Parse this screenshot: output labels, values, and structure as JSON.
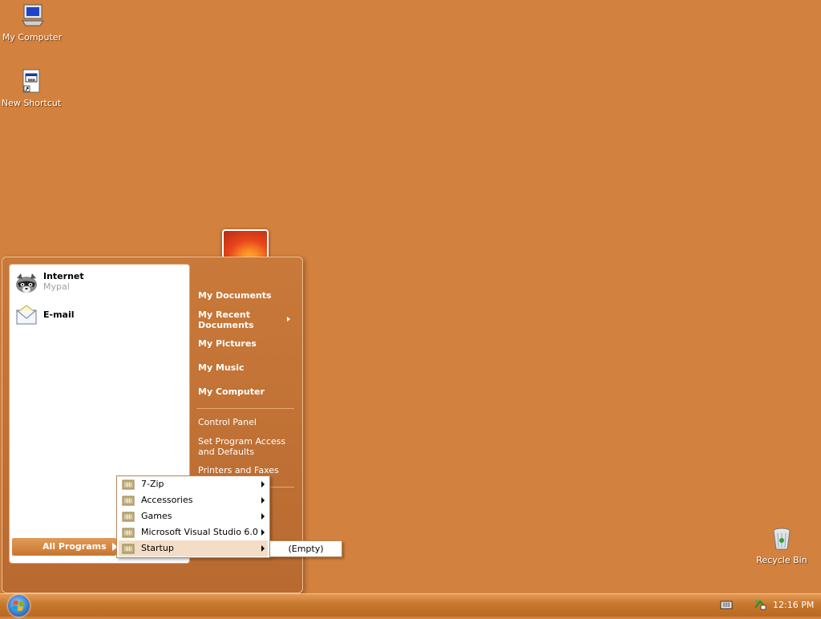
{
  "desktop": {
    "icons": [
      {
        "label": "My Computer",
        "icon": "computer-icon"
      },
      {
        "label": "New Shortcut",
        "icon": "shortcut-icon"
      },
      {
        "label": "Recycle Bin",
        "icon": "recycle-bin-icon"
      }
    ]
  },
  "start_menu": {
    "pinned": [
      {
        "title": "Internet",
        "subtitle": "Mypal",
        "icon": "raccoon-browser-icon"
      },
      {
        "title": "E-mail",
        "subtitle": "",
        "icon": "email-icon"
      }
    ],
    "all_programs_label": "All Programs",
    "right_items": [
      {
        "label": "My Documents"
      },
      {
        "label": "My Recent Documents"
      },
      {
        "label": "My Pictures"
      },
      {
        "label": "My Music"
      },
      {
        "label": "My Computer"
      },
      {
        "label": "Control Panel"
      },
      {
        "label": "Set Program Access and Defaults"
      },
      {
        "label": "Printers and Faxes"
      }
    ],
    "recent_docs_line1": "My Recent",
    "recent_docs_line2": "Documents",
    "spad_line1": "Set Program Access",
    "spad_line2": "and Defaults"
  },
  "programs_menu": {
    "items": [
      {
        "label": "7-Zip",
        "icon": "folder-icon"
      },
      {
        "label": "Accessories",
        "icon": "folder-icon"
      },
      {
        "label": "Games",
        "icon": "folder-icon"
      },
      {
        "label": "Microsoft Visual Studio 6.0",
        "icon": "folder-icon"
      },
      {
        "label": "Startup",
        "icon": "folder-icon"
      }
    ],
    "startup_submenu_label": "(Empty)"
  },
  "taskbar": {
    "clock": "12:16 PM"
  },
  "colors": {
    "desktop": "#d3813e",
    "menu_accent": "#c8762f"
  }
}
